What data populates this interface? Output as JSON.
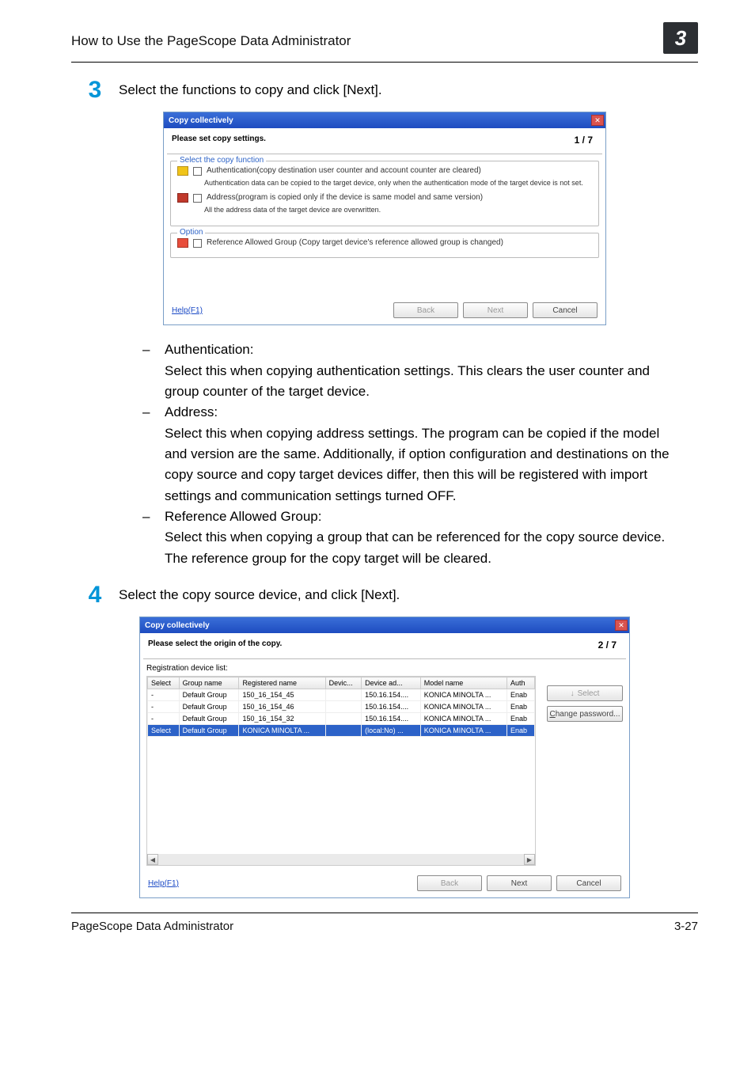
{
  "header": {
    "title": "How to Use the PageScope Data Administrator",
    "chapter_num": "3"
  },
  "steps": {
    "s3": {
      "num": "3",
      "text": "Select the functions to copy and click [Next]."
    },
    "s4": {
      "num": "4",
      "text": "Select the copy source device, and click [Next]."
    }
  },
  "dlg1": {
    "title": "Copy collectively",
    "head": "Please set copy settings.",
    "count": "1 / 7",
    "fs1_legend": "Select the copy function",
    "chk_auth": "Authentication(copy destination user counter and account counter are cleared)",
    "note_auth": "Authentication data can be copied to the target device, only when the authentication mode of the target device is not set.",
    "chk_addr": "Address(program is copied only if the device is same model and same version)",
    "note_addr": "All the address data of the target device are overwritten.",
    "fs2_legend": "Option",
    "chk_ref": "Reference Allowed Group (Copy target device's reference allowed group is changed)",
    "help": "Help(F1)",
    "btn_back": "Back",
    "btn_next": "Next",
    "btn_cancel": "Cancel"
  },
  "bullets": {
    "auth_head": "Authentication:",
    "auth_desc": "Select this when copying authentication settings. This clears the user counter and group counter of the target device.",
    "addr_head": "Address:",
    "addr_desc": "Select this when copying address settings. The program can be copied if the model and version are the same. Additionally, if option configuration and destinations on the copy source and copy target devices differ, then this will be registered with import settings and communication settings turned OFF.",
    "ref_head": "Reference Allowed Group:",
    "ref_desc": "Select this when copying a group that can be referenced for the copy source device. The reference group for the copy target will be cleared."
  },
  "dlg2": {
    "title": "Copy collectively",
    "head": "Please select the origin of the copy.",
    "count": "2 / 7",
    "list_label": "Registration device list:",
    "cols": {
      "c0": "Select",
      "c1": "Group name",
      "c2": "Registered name",
      "c3": "Devic...",
      "c4": "Device ad...",
      "c5": "Model name",
      "c6": "Auth"
    },
    "rows": [
      {
        "sel": "-",
        "group": "Default Group",
        "reg": "150_16_154_45",
        "dev": "",
        "addr": "150.16.154....",
        "model": "KONICA MINOLTA ...",
        "auth": "Enab"
      },
      {
        "sel": "-",
        "group": "Default Group",
        "reg": "150_16_154_46",
        "dev": "",
        "addr": "150.16.154....",
        "model": "KONICA MINOLTA ...",
        "auth": "Enab"
      },
      {
        "sel": "-",
        "group": "Default Group",
        "reg": "150_16_154_32",
        "dev": "",
        "addr": "150.16.154....",
        "model": "KONICA MINOLTA ...",
        "auth": "Enab"
      },
      {
        "sel": "Select",
        "group": "Default Group",
        "reg": "KONICA MINOLTA ...",
        "dev": "",
        "addr": "(local:No) ...",
        "model": "KONICA MINOLTA ...",
        "auth": "Enab"
      }
    ],
    "btn_select": "Select",
    "btn_chpw": "Change password...",
    "help": "Help(F1)",
    "btn_back": "Back",
    "btn_next": "Next",
    "btn_cancel": "Cancel"
  },
  "footer": {
    "left": "PageScope Data Administrator",
    "right": "3-27"
  }
}
